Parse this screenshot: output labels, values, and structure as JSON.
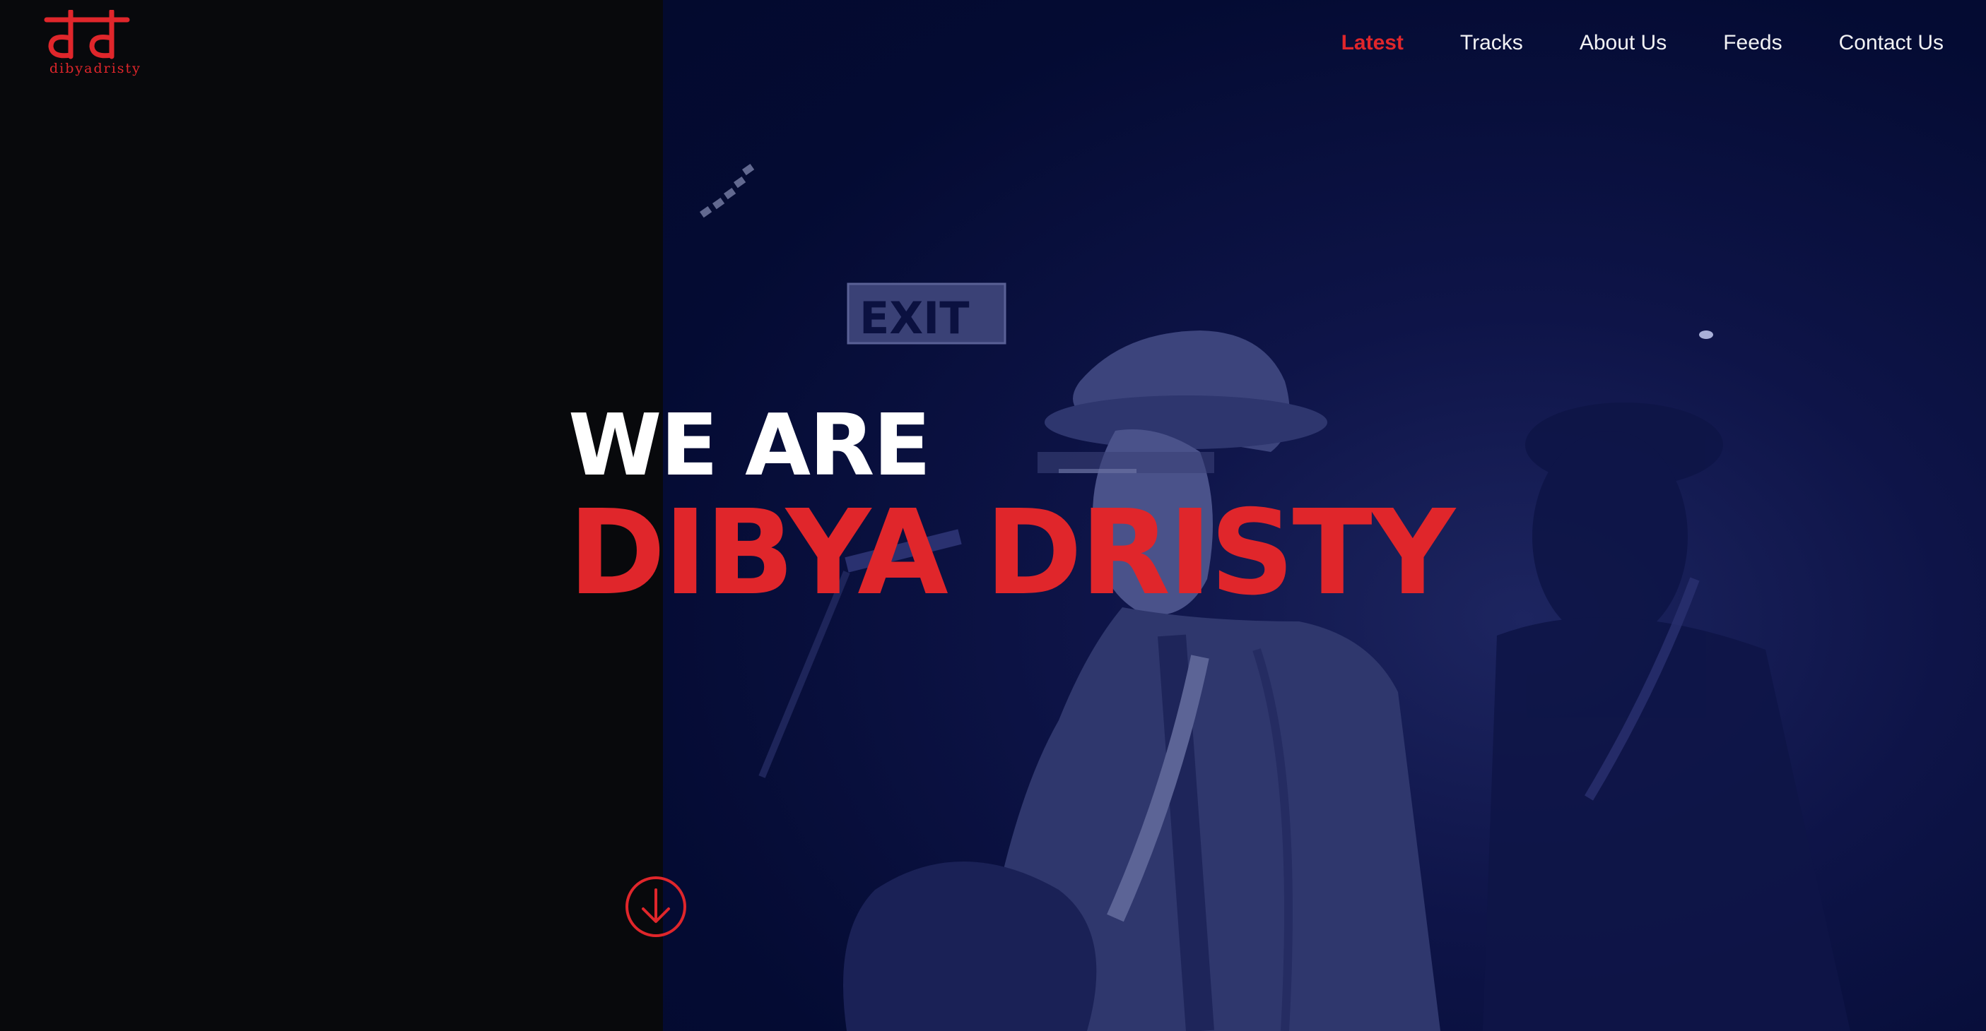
{
  "brand": {
    "logo_text": "dibyadristy",
    "accent_color": "#e0262b"
  },
  "nav": {
    "items": [
      {
        "label": "Latest",
        "active": true
      },
      {
        "label": "Tracks",
        "active": false
      },
      {
        "label": "About Us",
        "active": false
      },
      {
        "label": "Feeds",
        "active": false
      },
      {
        "label": "Contact Us",
        "active": false
      }
    ]
  },
  "hero": {
    "line1": "WE ARE",
    "line2": "DIBYA DRISTY",
    "scroll_icon": "arrow-down-circle-icon"
  },
  "background": {
    "photo": "musician-singing-with-guitar",
    "exit_sign": "EXIT"
  }
}
